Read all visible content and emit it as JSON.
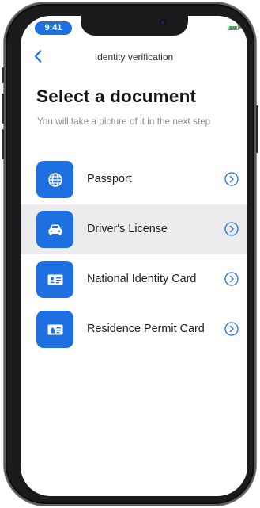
{
  "status_bar": {
    "time": "9:41",
    "battery_color": "#2ab64a"
  },
  "nav": {
    "title": "Identity verification",
    "back_icon": "chevron-left-icon"
  },
  "page": {
    "title": "Select a document",
    "subtitle": "You will take a picture of it in the next step"
  },
  "documents": [
    {
      "label": "Passport",
      "icon": "globe-icon",
      "selected": false
    },
    {
      "label": "Driver's License",
      "icon": "car-icon",
      "selected": true
    },
    {
      "label": "National Identity Card",
      "icon": "id-card-icon",
      "selected": false
    },
    {
      "label": "Residence Permit Card",
      "icon": "residence-card-icon",
      "selected": false
    }
  ],
  "colors": {
    "accent": "#1e6fe0",
    "selected_row": "#ececee",
    "text_secondary": "#8a8a8e"
  }
}
